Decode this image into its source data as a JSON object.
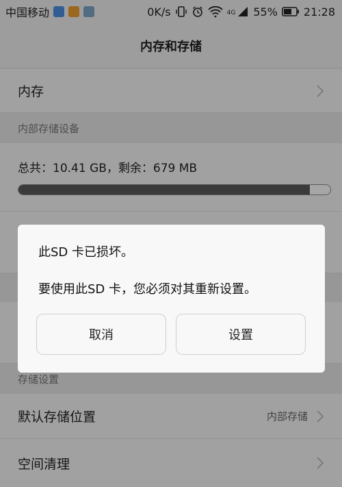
{
  "status_bar": {
    "carrier": "中国移动",
    "speed": "0K/s",
    "network": "4G",
    "battery": "55%",
    "time": "21:28"
  },
  "header": {
    "title": "内存和存储"
  },
  "list": {
    "memory_label": "内存",
    "internal_section": "内部存储设备",
    "storage_text": "总共：10.41 GB，剩余：679 MB",
    "storage_used_fraction": 0.935,
    "storage_settings_section": "存储设置",
    "default_location_label": "默认存储位置",
    "default_location_value": "内部存储",
    "cleanup_label": "空间清理"
  },
  "dialog": {
    "line1": "此SD 卡已损坏。",
    "line2": "要使用此SD 卡，您必须对其重新设置。",
    "cancel": "取消",
    "confirm": "设置"
  }
}
